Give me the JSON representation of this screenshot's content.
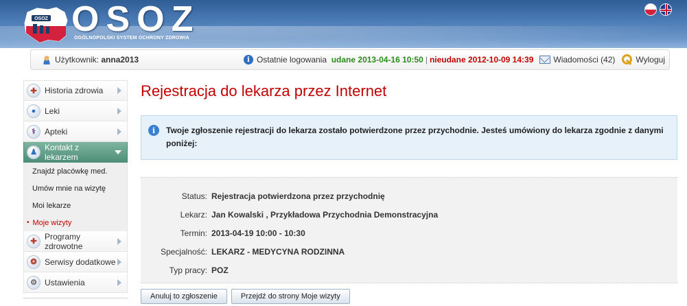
{
  "header": {
    "logo_text": "OSOZ",
    "logo_subtitle": "OGÓLNOPOLSKI SYSTEM OCHRONY ZDROWIA",
    "logo_map_label": "OSOZ",
    "flags": [
      "flag-pl-icon",
      "flag-uk-icon"
    ]
  },
  "userbar": {
    "user_label": "Użytkownik:",
    "username": "anna2013",
    "last_login_label": "Ostatnie logowania",
    "success_label": "udane",
    "success_time": "2013-04-16 10:50",
    "separator": "|",
    "failed_label": "nieudane",
    "failed_time": "2012-10-09 14:39",
    "messages": "Wiadomości (42)",
    "logout": "Wyloguj"
  },
  "sidebar": {
    "items": [
      {
        "label": "Historia zdrowia",
        "icon": "health-history-icon"
      },
      {
        "label": "Leki",
        "icon": "pills-icon"
      },
      {
        "label": "Apteki",
        "icon": "pharmacy-icon"
      },
      {
        "label": "Kontakt z lekarzem",
        "icon": "doctor-icon",
        "active": true
      }
    ],
    "subitems": [
      {
        "label": "Znajdź placówkę med."
      },
      {
        "label": "Umów mnie na wizytę"
      },
      {
        "label": "Moi lekarze"
      },
      {
        "label": "Moje wizyty",
        "current": true
      }
    ],
    "items_after": [
      {
        "label": "Programy zdrowotne",
        "icon": "health-programs-icon"
      },
      {
        "label": "Serwisy dodatkowe",
        "icon": "extra-services-icon"
      },
      {
        "label": "Ustawienia",
        "icon": "settings-icon"
      }
    ]
  },
  "main": {
    "title": "Rejestracja do lekarza przez Internet",
    "info_message": "Twoje zgłoszenie rejestracji do lekarza zostało potwierdzone przez przychodnie. Jesteś umówiony do lekarza zgodnie z danymi poniżej:",
    "details": [
      {
        "label": "Status:",
        "value": "Rejestracja potwierdzona przez przychodnię"
      },
      {
        "label": "Lekarz:",
        "value": "Jan Kowalski , Przykładowa Przychodnia Demonstracyjna"
      },
      {
        "label": "Termin:",
        "value": "2013-04-19 10:00 - 10:30"
      },
      {
        "label": "Specjalność:",
        "value": "LEKARZ - MEDYCYNA RODZINNA"
      },
      {
        "label": "Typ pracy:",
        "value": "POZ"
      }
    ],
    "buttons": {
      "cancel": "Anuluj to zgłoszenie",
      "goto_visits": "Przejdź do strony Moje wizyty"
    }
  },
  "colors": {
    "accent_red": "#c00000",
    "success_green": "#2d8a1e",
    "nav_active": "#5e9c86",
    "header_blue": "#4d7db7"
  }
}
